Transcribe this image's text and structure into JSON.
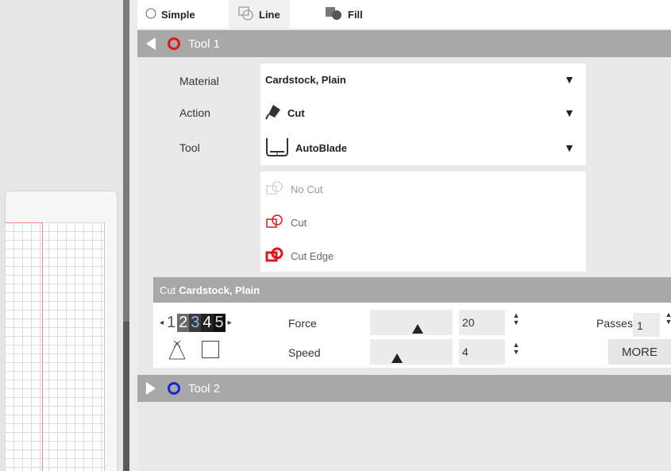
{
  "tabs": {
    "simple": "Simple",
    "line": "Line",
    "fill": "Fill"
  },
  "tool1": {
    "title": "Tool 1",
    "ring_color": "#e0161b",
    "labels": {
      "material": "Material",
      "action": "Action",
      "tool": "Tool"
    },
    "material_value": "Cardstock, Plain",
    "action_value": "Cut",
    "tool_value": "AutoBlade",
    "cut_options": [
      {
        "label": "No Cut",
        "state": "disabled"
      },
      {
        "label": "Cut",
        "state": "normal"
      },
      {
        "label": "Cut Edge",
        "state": "normal"
      }
    ]
  },
  "cut_settings": {
    "header_prefix": "Cut",
    "header_material": "Cardstock, Plain",
    "blade_numbers": [
      "1",
      "2",
      "3",
      "4",
      "5"
    ],
    "force_label": "Force",
    "force_value": "20",
    "force_level": 0.5,
    "speed_label": "Speed",
    "speed_value": "4",
    "speed_level": 0.3,
    "passes_label": "Passes",
    "passes_value": "1",
    "more_label": "MORE"
  },
  "tool2": {
    "title": "Tool 2",
    "ring_color": "#1428d8"
  },
  "colors": {
    "header_gray": "#a8a8a8",
    "panel_bg": "#e9e9e9",
    "cut_red": "#e0161b"
  }
}
